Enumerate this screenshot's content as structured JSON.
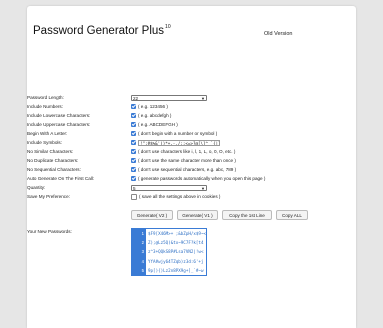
{
  "app": {
    "title": "Password Generator Plus",
    "title_sup": "10",
    "old_version_link": "Old Version"
  },
  "form": {
    "length": {
      "label": "Password Length:",
      "value": "22"
    },
    "numbers": {
      "label": "Include Numbers:",
      "checked": true,
      "hint": "( e.g. 123456 )"
    },
    "lowercase": {
      "label": "Include Lowercase Characters:",
      "checked": true,
      "hint": "( e.g. abcdefgh )"
    },
    "uppercase": {
      "label": "Include Uppercase Characters:",
      "checked": true,
      "hint": "( e.g. ABCDEFGH )"
    },
    "letter": {
      "label": "Begin With A Letter:",
      "checked": true,
      "hint": "( don't begin with a number or symbol )"
    },
    "symbols": {
      "label": "Include Symbols:",
      "checked": true,
      "value": "!\";#$%&'()*+,-./:;<=>?@[\\]^_`{|}~"
    },
    "similar": {
      "label": "No Similar Characters:",
      "checked": true,
      "hint": "( don't use characters like i, l, 1, L, o, 0, O, etc. )"
    },
    "duplicate": {
      "label": "No Duplicate Characters:",
      "checked": true,
      "hint": "( don't use the same character more than once )"
    },
    "sequential": {
      "label": "No Sequential Characters:",
      "checked": true,
      "hint": "( don't use sequential characters, e.g. abc, 789 )"
    },
    "auto": {
      "label": "Auto Generate On The First Call:",
      "checked": true,
      "hint": "( generate passwords automatically when you open this page )"
    },
    "quantity": {
      "label": "Quantity:",
      "value": "5"
    },
    "save": {
      "label": "Save My Preference:",
      "checked": false,
      "hint": "( save all the settings above in cookies )"
    }
  },
  "buttons": {
    "gen2": "Generate( V2 )",
    "gen1": "Generate( V1 )",
    "copy1": "Copy the 1st Line",
    "copyall": "Copy ALL"
  },
  "passwords": {
    "label": "Your New Passwords:",
    "lines": [
      {
        "n": "1",
        "text": "$F9[X46M>+ ;&bZpH/x$9~<"
      },
      {
        "n": "2",
        "text": "Z);@Lz5Q(&tx~9C7F?k[t4"
      },
      {
        "n": "3",
        "text": "z^3+QQkS8P#Lsa7VN2|!w<"
      },
      {
        "n": "4",
        "text": "YfA#wjy64TZqb)z3d:6'+j"
      },
      {
        "n": "5",
        "text": "9p[){)Lz2n8PX9g+]_`#~w"
      }
    ]
  },
  "colors": {
    "accent": "#3a7bd5",
    "background": "#e6e6e6",
    "panel": "#ffffff"
  }
}
